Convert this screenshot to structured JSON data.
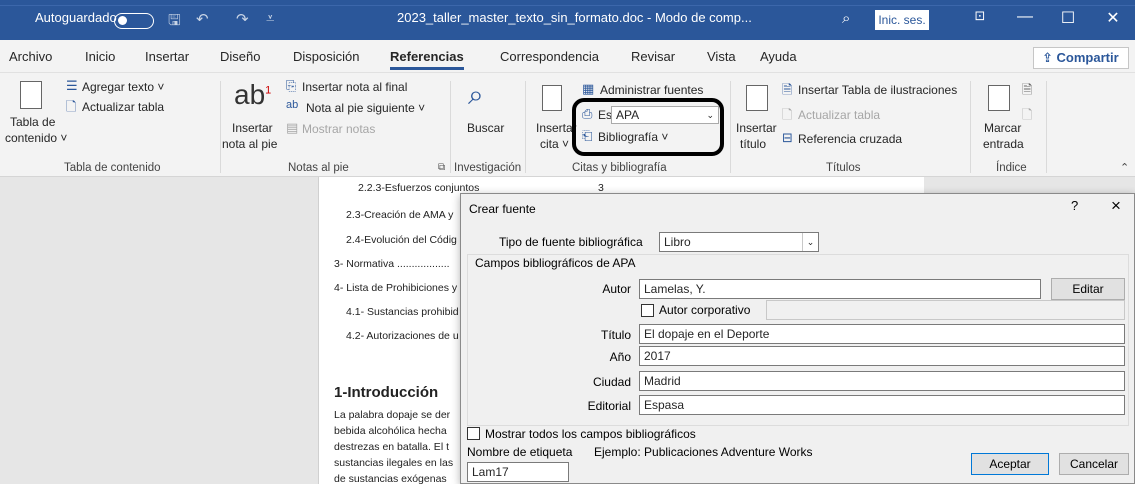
{
  "titlebar": {
    "autosave_label": "Autoguardado",
    "document_title": "2023_taller_master_texto_sin_formato.doc  -  Modo de comp...",
    "signin_label": "Inic. ses."
  },
  "tabs": [
    "Archivo",
    "Inicio",
    "Insertar",
    "Diseño",
    "Disposición",
    "Referencias",
    "Correspondencia",
    "Revisar",
    "Vista",
    "Ayuda"
  ],
  "active_tab": "Referencias",
  "share_label": "Compartir",
  "ribbon": {
    "toc": {
      "table_label_1": "Tabla de",
      "table_label_2": "contenido ˅",
      "add_text": "Agregar texto ˅",
      "update_table": "Actualizar tabla",
      "group": "Tabla de contenido"
    },
    "footnotes": {
      "insert_1": "Insertar",
      "insert_2": "nota al pie",
      "endnote": "Insertar nota al final",
      "next": "Nota al pie siguiente  ˅",
      "show": "Mostrar notas",
      "group": "Notas al pie"
    },
    "research": {
      "search": "Buscar",
      "group": "Investigación"
    },
    "citations": {
      "insert_1": "Insertar",
      "insert_2": "cita ˅",
      "manage": "Administrar fuentes",
      "style_label": "Estilo:",
      "style_value": "APA",
      "bibliography": "Bibliografía ˅",
      "group": "Citas y bibliografía"
    },
    "captions": {
      "insert_1": "Insertar",
      "insert_2": "título",
      "insert_table": "Insertar Tabla de ilustraciones",
      "update": "Actualizar tabla",
      "cross_ref": "Referencia cruzada",
      "group": "Títulos"
    },
    "index": {
      "mark_1": "Marcar",
      "mark_2": "entrada",
      "group": "Índice"
    }
  },
  "document": {
    "toc_lines": [
      "2.2.3-Esfuerzos conjuntos",
      "2.3-Creación de AMA y",
      "2.4-Evolución del Códig",
      "3- Normativa ..................",
      "4- Lista de Prohibiciones y",
      "4.1- Sustancias prohibid",
      "4.2- Autorizaciones de u"
    ],
    "toc_page": "3",
    "heading": "1-Introducción",
    "body_lines": [
      "La palabra dopaje se der",
      "bebida alcohólica hecha",
      "destrezas en batalla. El t",
      "sustancias ilegales en las",
      "de sustancias exógenas"
    ]
  },
  "dialog": {
    "title": "Crear fuente",
    "help": "?",
    "close": "×",
    "source_type_label": "Tipo de fuente bibliográfica",
    "source_type_value": "Libro",
    "fields_group": "Campos bibliográficos de APA",
    "author_label": "Autor",
    "author_value": "Lamelas, Y.",
    "edit_button": "Editar",
    "corporate_label": "Autor corporativo",
    "title_label": "Título",
    "title_value": "El dopaje en el Deporte",
    "year_label": "Año",
    "year_value": "2017",
    "city_label": "Ciudad",
    "city_value": "Madrid",
    "publisher_label": "Editorial",
    "publisher_value": "Espasa",
    "show_all_label": "Mostrar todos los campos bibliográficos",
    "tag_name_label": "Nombre de etiqueta",
    "example_label": "Ejemplo: Publicaciones Adventure Works",
    "tag_value": "Lam17",
    "ok_button": "Aceptar",
    "cancel_button": "Cancelar"
  }
}
